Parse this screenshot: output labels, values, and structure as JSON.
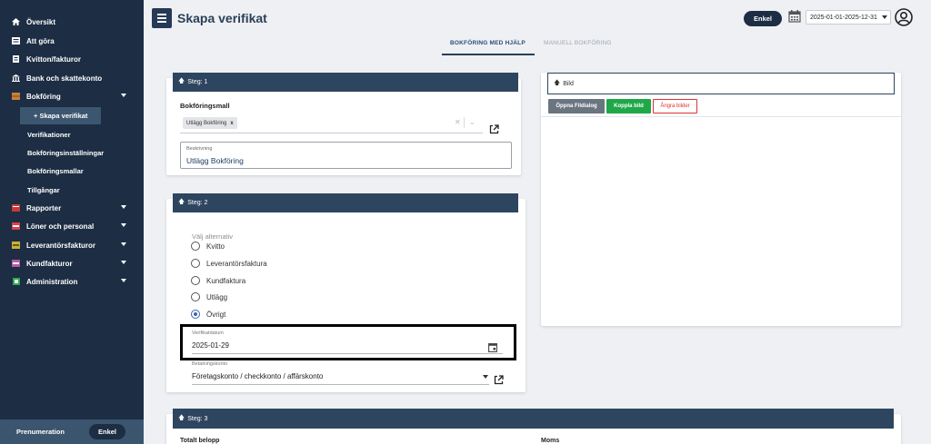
{
  "sidebar": {
    "items": [
      {
        "label": "Översikt",
        "icon": "home-icon"
      },
      {
        "label": "Att göra",
        "icon": "list-icon"
      },
      {
        "label": "Kvitton/fakturor",
        "icon": "receipt-icon"
      },
      {
        "label": "Bank och skattekonto",
        "icon": "bank-icon"
      },
      {
        "label": "Bokföring",
        "icon": "book-icon"
      },
      {
        "label": "Rapporter",
        "icon": "report-icon"
      },
      {
        "label": "Löner och personal",
        "icon": "people-icon"
      },
      {
        "label": "Leverantörsfakturor",
        "icon": "invoice-in-icon"
      },
      {
        "label": "Kundfakturor",
        "icon": "invoice-out-icon"
      },
      {
        "label": "Administration",
        "icon": "admin-icon"
      }
    ],
    "active_sub": "+ Skapa verifikat",
    "sub_items": [
      "Verifikationer",
      "Bokföringsinställningar",
      "Bokföringsmallar",
      "Tillgångar"
    ],
    "footer": {
      "label": "Prenumeration",
      "plan": "Enkel"
    }
  },
  "header": {
    "title": "Skapa verifikat",
    "plan_badge": "Enkel",
    "date_range": "2025-01-01-2025-12-31"
  },
  "tabs": [
    {
      "label": "BOKFÖRING MED HJÄLP",
      "active": true
    },
    {
      "label": "MANUELL BOKFÖRING",
      "active": false
    }
  ],
  "step1": {
    "header": "Steg: 1",
    "template_label": "Bokföringsmall",
    "template_chip": "Utlägg Bokföring",
    "chip_remove": "x",
    "description_label": "Beskrivning",
    "description_value": "Utlägg Bokföring"
  },
  "step2": {
    "header": "Steg: 2",
    "choose_label": "Välj alternativ",
    "options": [
      {
        "label": "Kvitto",
        "selected": false
      },
      {
        "label": "Leverantörsfaktura",
        "selected": false
      },
      {
        "label": "Kundfaktura",
        "selected": false
      },
      {
        "label": "Utlägg",
        "selected": false
      },
      {
        "label": "Övrigt",
        "selected": true
      }
    ],
    "date_label": "Verifikatdatum",
    "date_value": "2025-01-29",
    "account_label": "Betalningskonto",
    "account_value": "Företagskonto / checkkonto / affärskonto"
  },
  "image_panel": {
    "header": "Bild",
    "buttons": {
      "open": "Öppna Fildialog",
      "link": "Koppla bild",
      "undo": "Ångra bilder"
    }
  },
  "step3": {
    "header": "Steg: 3",
    "total_label": "Totalt belopp",
    "vat_label": "Moms"
  },
  "colors": {
    "sidebar_bg": "#1c2d44",
    "header_bar": "#2e4560",
    "green": "#1fa847",
    "danger": "#dd3333"
  }
}
